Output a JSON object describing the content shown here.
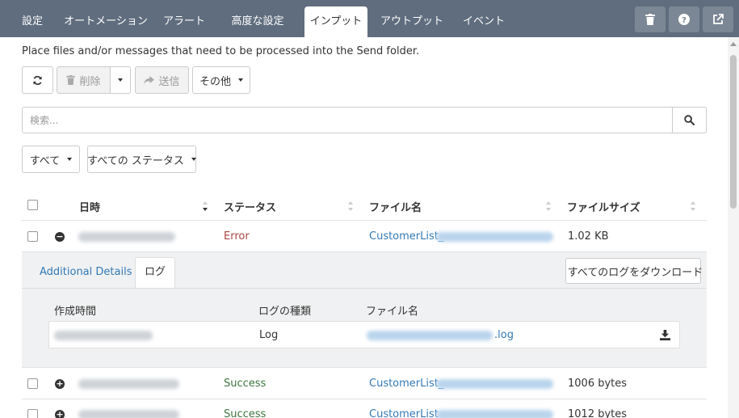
{
  "tabs": [
    {
      "label": "設定",
      "active": false
    },
    {
      "label": "オートメーション",
      "active": false
    },
    {
      "label": "アラート",
      "active": false
    },
    {
      "label": "高度な設定",
      "active": false
    },
    {
      "label": "インプット",
      "active": true
    },
    {
      "label": "アウトプット",
      "active": false
    },
    {
      "label": "イベント",
      "active": false
    }
  ],
  "top_icons": [
    "trash-icon",
    "help-icon",
    "external-link-icon"
  ],
  "instruction": "Place files and/or messages that need to be processed into the  Send folder.",
  "toolbar": {
    "refresh_icon": "refresh-icon",
    "delete_label": "削除",
    "send_label": "送信",
    "more_label": "その他"
  },
  "search": {
    "placeholder": "検索..."
  },
  "filters": {
    "all_label": "すべて",
    "status_label": "すべての ステータス"
  },
  "table": {
    "headers": {
      "datetime": "日時",
      "status": "ステータス",
      "filename": "ファイル名",
      "filesize": "ファイルサイズ"
    },
    "rows": [
      {
        "status": "Error",
        "status_type": "error",
        "filename_prefix": "CustomerList_",
        "size": "1.02 KB",
        "expanded": true
      },
      {
        "status": "Success",
        "status_type": "success",
        "filename_prefix": "CustomerList_",
        "size": "1006 bytes",
        "expanded": false
      },
      {
        "status": "Success",
        "status_type": "success",
        "filename_prefix": "CustomerList_",
        "size": "1012 bytes",
        "expanded": false
      }
    ]
  },
  "detail": {
    "tab_additional": "Additional Details",
    "tab_log": "ログ",
    "download_all": "すべてのログをダウンロード",
    "headers": {
      "created": "作成時間",
      "type": "ログの種類",
      "filename": "ファイル名"
    },
    "log_row": {
      "type": "Log",
      "file_suffix": ".log"
    }
  },
  "colors": {
    "topbar": "#5f6d7e",
    "error": "#a94442",
    "success": "#3c763d",
    "link": "#337ab7"
  }
}
